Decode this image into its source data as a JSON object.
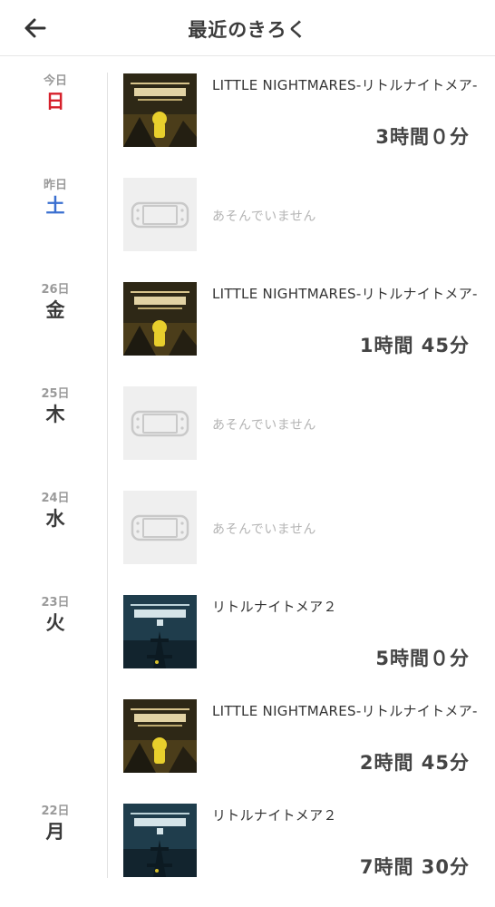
{
  "header": {
    "title": "最近のきろく",
    "back_icon": "arrow-left-icon"
  },
  "games": {
    "ln1": "LITTLE NIGHTMARES-リトルナイトメア-",
    "ln2": "リトルナイトメア２"
  },
  "empty_text": "あそんでいません",
  "days": [
    {
      "rel": "今日",
      "weekday": "日"
    },
    {
      "rel": "昨日",
      "weekday": "土"
    },
    {
      "rel": "26日",
      "weekday": "金"
    },
    {
      "rel": "25日",
      "weekday": "木"
    },
    {
      "rel": "24日",
      "weekday": "水"
    },
    {
      "rel": "23日",
      "weekday": "火"
    },
    {
      "rel": "22日",
      "weekday": "月"
    }
  ],
  "entries": [
    {
      "game": "LITTLE NIGHTMARES-リトルナイトメア-",
      "time": "3時間０分"
    },
    {
      "game": "LITTLE NIGHTMARES-リトルナイトメア-",
      "time": "1時間 45分"
    },
    {
      "game": "リトルナイトメア２",
      "time": "5時間０分"
    },
    {
      "game": "LITTLE NIGHTMARES-リトルナイトメア-",
      "time": "2時間 45分"
    },
    {
      "game": "リトルナイトメア２",
      "time": "7時間 30分"
    }
  ],
  "colors": {
    "sunday": "#d6202b",
    "saturday": "#3a6fd0",
    "line": "#e2e2e2"
  }
}
